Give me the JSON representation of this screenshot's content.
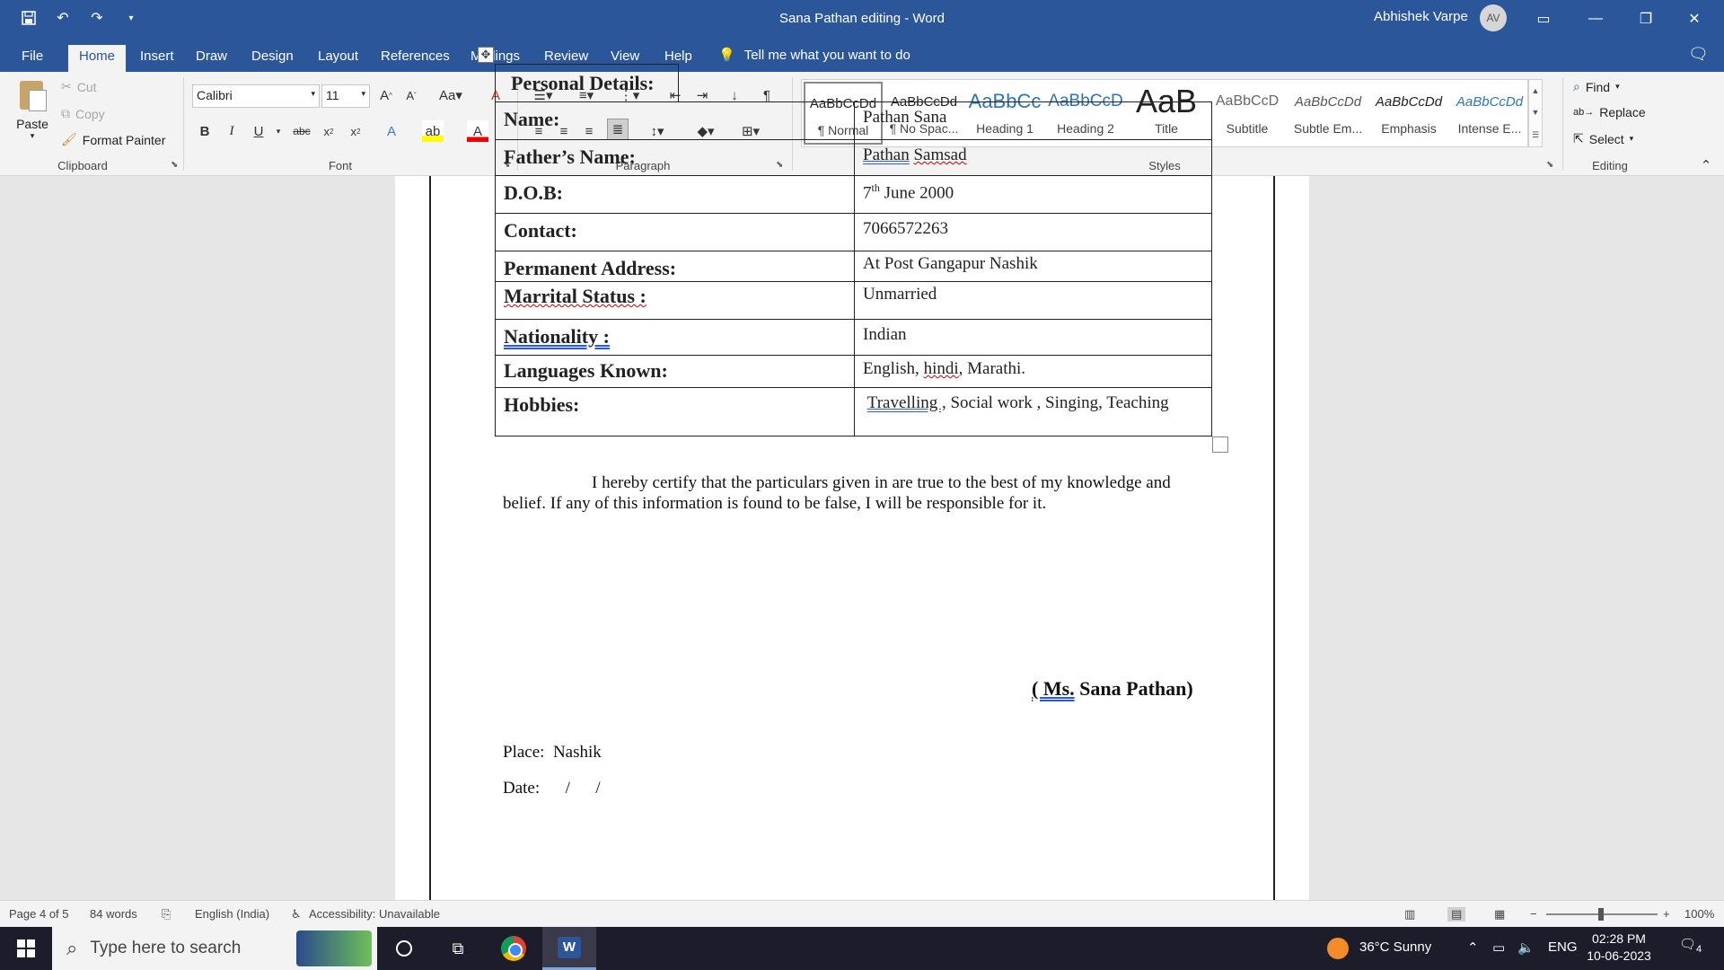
{
  "window": {
    "title": "Sana Pathan editing  -  Word",
    "user_name": "Abhishek Varpe",
    "user_initials": "AV"
  },
  "menu": {
    "tabs": [
      "File",
      "Home",
      "Insert",
      "Draw",
      "Design",
      "Layout",
      "References",
      "Mailings",
      "Review",
      "View",
      "Help"
    ],
    "active_tab": "Home",
    "tell_me": "Tell me what you want to do"
  },
  "ribbon": {
    "clipboard": {
      "paste": "Paste",
      "cut": "Cut",
      "copy": "Copy",
      "format_painter": "Format Painter",
      "label": "Clipboard"
    },
    "font": {
      "name": "Calibri",
      "size": "11",
      "label": "Font"
    },
    "paragraph": {
      "label": "Paragraph"
    },
    "styles": {
      "label": "Styles",
      "items": [
        {
          "sample": "AaBbCcDd",
          "name": "¶ Normal"
        },
        {
          "sample": "AaBbCcDd",
          "name": "¶ No Spac..."
        },
        {
          "sample": "AaBbCc",
          "name": "Heading 1"
        },
        {
          "sample": "AaBbCcD",
          "name": "Heading 2"
        },
        {
          "sample": "AaB",
          "name": "Title"
        },
        {
          "sample": "AaBbCcD",
          "name": "Subtitle"
        },
        {
          "sample": "AaBbCcDd",
          "name": "Subtle Em..."
        },
        {
          "sample": "AaBbCcDd",
          "name": "Emphasis"
        },
        {
          "sample": "AaBbCcDd",
          "name": "Intense E..."
        }
      ]
    },
    "editing": {
      "find": "Find",
      "replace": "Replace",
      "select": "Select",
      "label": "Editing"
    }
  },
  "document": {
    "section_heading": "Personal Details:",
    "rows": [
      {
        "label": "Name:",
        "value": "Pathan Sana"
      },
      {
        "label": "Father’s Name:",
        "value_a": "Pathan",
        "value_b": "Samsad"
      },
      {
        "label": "D.O.B:",
        "value_a": "7",
        "value_sup": "th",
        "value_b": " June 2000"
      },
      {
        "label": "Contact:",
        "value": "7066572263"
      },
      {
        "label": "Permanent Address:",
        "value": "At Post Gangapur Nashik"
      },
      {
        "label": "Marrital Status :",
        "value": " Unmarried"
      },
      {
        "label": "Nationality :",
        "value": "Indian"
      },
      {
        "label": "Languages Known:",
        "value_a": "English, ",
        "value_b": "hindi",
        "value_c": ", Marathi."
      },
      {
        "label": "Hobbies:",
        "value_a": "Travelling ,",
        "value_b": " Social work , Singing, Teaching"
      }
    ],
    "certification": "I hereby certify that the particulars given in are true to the best of my knowledge and belief. If any of this information is found to be false, I will be responsible for it.",
    "place_label": "Place:",
    "place_value": "Nashik",
    "date_label": "Date:",
    "date_value": "/      /",
    "signature_open": "( Ms.",
    "signature_rest": " Sana Pathan)"
  },
  "status": {
    "page": "Page 4 of 5",
    "words": "84 words",
    "language": "English (India)",
    "accessibility": "Accessibility: Unavailable",
    "zoom": "100%",
    "zoom_level_percent": 100
  },
  "taskbar": {
    "search_placeholder": "Type here to search",
    "weather": "36°C  Sunny",
    "lang": "ENG",
    "time": "02:28 PM",
    "date": "10-06-2023",
    "notifications": "4"
  }
}
